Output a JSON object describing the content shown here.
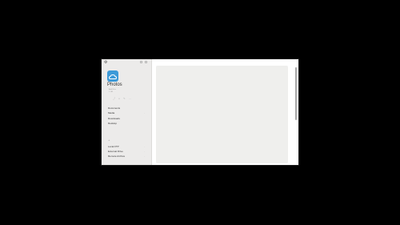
{
  "sidebar": {
    "app_name": "Photos",
    "subtitle_lines": [
      "Add Files",
      "1 GB"
    ],
    "toolbar_icons": [
      "share-icon",
      "trash-icon",
      "edit-icon",
      "more-icon"
    ],
    "nav_items": [
      {
        "label": "Documents",
        "mark": ""
      },
      {
        "label": "Media",
        "mark": "·"
      },
      {
        "label": "Downloads",
        "mark": ""
      },
      {
        "label": "Desktop",
        "mark": ""
      }
    ],
    "section_mark": "+",
    "storage_items": [
      {
        "label": "Local FTP",
        "mark": "·"
      },
      {
        "label": "External Drive",
        "mark": "·"
      },
      {
        "label": "Remote Archive",
        "mark": "·"
      }
    ]
  },
  "colors": {
    "app_icon": "#3d9ad8",
    "sidebar_bg": "#ecebea",
    "content_bg": "#efefed",
    "page_bg": "#000000"
  }
}
